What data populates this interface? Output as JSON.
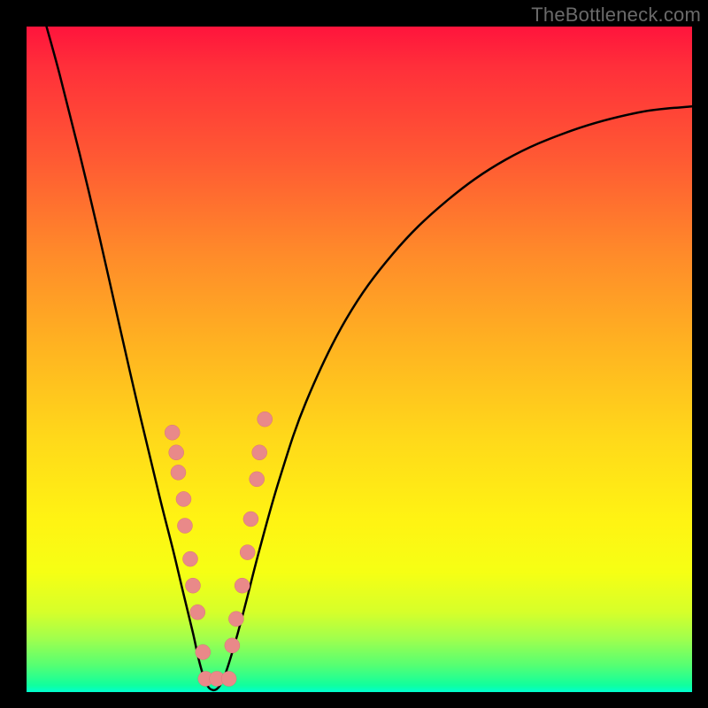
{
  "attribution": "TheBottleneck.com",
  "colors": {
    "gradient_top": "#ff143c",
    "gradient_bottom": "#00ffd0",
    "curve": "#000000",
    "dot": "#e98989",
    "frame": "#000000"
  },
  "chart_data": {
    "type": "line",
    "title": "",
    "xlabel": "",
    "ylabel": "",
    "xlim": [
      0,
      100
    ],
    "ylim": [
      0,
      100
    ],
    "grid": false,
    "notes": "V-shaped bottleneck curve with salmon-colored sample markers clustered near the minimum. Vertical axis reads high (red) at top to low (green) at bottom; curve minimum near x≈27, y≈0.",
    "curve_points": [
      {
        "x": 3.0,
        "y": 100.0
      },
      {
        "x": 5.0,
        "y": 92.7
      },
      {
        "x": 8.0,
        "y": 80.8
      },
      {
        "x": 11.0,
        "y": 68.2
      },
      {
        "x": 14.0,
        "y": 54.9
      },
      {
        "x": 17.0,
        "y": 41.8
      },
      {
        "x": 20.0,
        "y": 29.3
      },
      {
        "x": 22.0,
        "y": 21.4
      },
      {
        "x": 23.5,
        "y": 15.1
      },
      {
        "x": 25.0,
        "y": 8.9
      },
      {
        "x": 26.0,
        "y": 4.4
      },
      {
        "x": 27.0,
        "y": 1.3
      },
      {
        "x": 28.0,
        "y": 0.3
      },
      {
        "x": 29.0,
        "y": 0.9
      },
      {
        "x": 30.0,
        "y": 3.1
      },
      {
        "x": 31.5,
        "y": 8.0
      },
      {
        "x": 33.0,
        "y": 13.6
      },
      {
        "x": 35.0,
        "y": 21.4
      },
      {
        "x": 38.0,
        "y": 32.0
      },
      {
        "x": 42.0,
        "y": 43.6
      },
      {
        "x": 48.0,
        "y": 56.0
      },
      {
        "x": 55.0,
        "y": 65.8
      },
      {
        "x": 63.0,
        "y": 73.7
      },
      {
        "x": 72.0,
        "y": 80.0
      },
      {
        "x": 82.0,
        "y": 84.4
      },
      {
        "x": 92.0,
        "y": 87.1
      },
      {
        "x": 100.0,
        "y": 88.0
      }
    ],
    "series": [
      {
        "name": "left-branch-markers",
        "points": [
          {
            "x": 21.9,
            "y": 39.0
          },
          {
            "x": 22.5,
            "y": 36.0
          },
          {
            "x": 22.8,
            "y": 33.0
          },
          {
            "x": 23.6,
            "y": 29.0
          },
          {
            "x": 23.8,
            "y": 25.0
          },
          {
            "x": 24.6,
            "y": 20.0
          },
          {
            "x": 25.0,
            "y": 16.0
          },
          {
            "x": 25.7,
            "y": 12.0
          },
          {
            "x": 26.5,
            "y": 6.0
          }
        ]
      },
      {
        "name": "bottom-markers",
        "points": [
          {
            "x": 26.9,
            "y": 2.0
          },
          {
            "x": 28.6,
            "y": 2.0
          },
          {
            "x": 30.4,
            "y": 2.0
          }
        ]
      },
      {
        "name": "right-branch-markers",
        "points": [
          {
            "x": 30.9,
            "y": 7.0
          },
          {
            "x": 31.5,
            "y": 11.0
          },
          {
            "x": 32.4,
            "y": 16.0
          },
          {
            "x": 33.2,
            "y": 21.0
          },
          {
            "x": 33.7,
            "y": 26.0
          },
          {
            "x": 34.6,
            "y": 32.0
          },
          {
            "x": 35.0,
            "y": 36.0
          },
          {
            "x": 35.8,
            "y": 41.0
          }
        ]
      }
    ]
  }
}
